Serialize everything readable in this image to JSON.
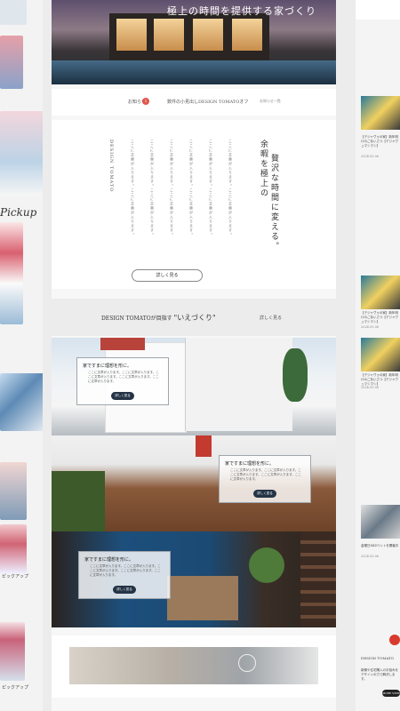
{
  "hero": {
    "title": "極上の時間を提供する家づくり"
  },
  "news": {
    "label": "お知らせ",
    "badge": "1",
    "item": "数件の小見出しDESIGN TOMATOオフ",
    "more": "お知らせ一覧"
  },
  "concept": {
    "brand": "DESIGN TOMATO",
    "headline_1": "余暇を極上の",
    "headline_2": "贅沢な時間に変える。",
    "body_lines": [
      "ここに文章が入ります。ここに文章が入ります。",
      "ここに文章が入ります。ここに文章が入ります。",
      "ここに文章が入ります。ここに文章が入ります。",
      "ここに文章が入ります。ここに文章が入ります。",
      "ここに文章が入ります。ここに文章が入ります。",
      "ここに文章が入ります。ここに文章が入ります。"
    ],
    "button": "詳しく見る"
  },
  "ie": {
    "title_prefix": "DESIGN TOMATOが目指す",
    "title_main": "\"いえづくり\"",
    "more": "詳しく見る"
  },
  "cards": [
    {
      "title": "家ですまに理想を形に。",
      "text": "ここに文章が入ります。ここに文章が入ります。ここに文章が入ります。ここに文章が入ります。ここに文章が入ります。",
      "button": "詳しく見る"
    },
    {
      "title": "家ですまに理想を形に。",
      "text": "ここに文章が入ります。ここに文章が入ります。ここに文章が入ります。ここに文章が入ります。ここに文章が入ります。",
      "button": "詳しく見る"
    },
    {
      "title": "家ですまに理想を形に。",
      "text": "ここに文章が入ります。ここに文章が入ります。ここに文章が入ります。ここに文章が入ります。ここに文章が入ります。",
      "button": "詳しく見る"
    }
  ],
  "left_strip": {
    "pickup": "Pickup",
    "captions": [
      "ピックアップ",
      "ピックアップ"
    ]
  },
  "right_strip": {
    "items": [
      {
        "text": "【デジャヴゥの家】新年明けのごあいさつ【デジャヴュマシマシ】",
        "date": "2024.05.06"
      },
      {
        "text": "【デジャヴゥの家】新年明けのごあいさつ【デジャヴュマシマシ】",
        "date": "2024.05.06"
      },
      {
        "text": "【デジャヴゥの家】新年明けのごあいさつ【デジャヴュマシマシ】",
        "date": "2024.05.06"
      },
      {
        "text": "金曜日MIZベントを開催中",
        "date": "2024.05.06"
      }
    ],
    "footer_brand": "DESIGN TOMATO",
    "footer_text": "新築や住宅購入のお悩みをデザインの力で解決します。",
    "footer_button": "MORE VIEW"
  },
  "colors": {
    "accent": "#e2574c",
    "navy": "#243446"
  }
}
